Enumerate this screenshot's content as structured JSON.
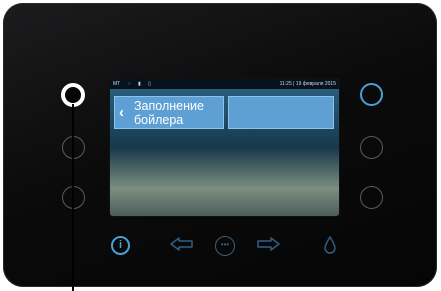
{
  "status_bar": {
    "left_text": "MT",
    "time_date": "11:25 | 19 февраля 2015"
  },
  "tiles": [
    {
      "label": "Заполнение бойлера",
      "back_icon": "chevron-left-icon"
    },
    {
      "label": ""
    }
  ],
  "hardware_buttons": {
    "left_count": 3,
    "right_count": 3,
    "selected": "left-top"
  },
  "bottom_bar_icons": [
    "info-icon",
    "arrow-left-icon",
    "menu-dots-icon",
    "arrow-right-icon",
    "drop-icon"
  ],
  "colors": {
    "accent": "#4b9fd6",
    "panel": "#0b0b0c",
    "tile": "#5ea0d3"
  }
}
